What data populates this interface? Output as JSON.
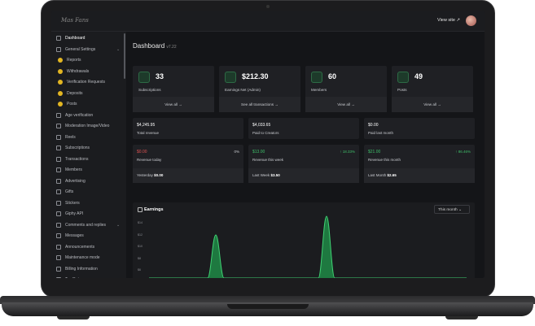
{
  "topbar": {
    "logo": "Mas Fans",
    "view_site": "View site ↗"
  },
  "sidebar": {
    "items": [
      {
        "label": "Dashboard",
        "active": true
      },
      {
        "label": "General Settings",
        "expand": true
      },
      {
        "label": "Reports",
        "sub": true
      },
      {
        "label": "Withdrawals",
        "sub": true
      },
      {
        "label": "Verification Requests",
        "sub": true
      },
      {
        "label": "Deposits",
        "sub": true
      },
      {
        "label": "Posts",
        "sub": true
      },
      {
        "label": "Age verification"
      },
      {
        "label": "Moderation Image/Video"
      },
      {
        "label": "Reels"
      },
      {
        "label": "Subscriptions"
      },
      {
        "label": "Transactions"
      },
      {
        "label": "Members"
      },
      {
        "label": "Advertising"
      },
      {
        "label": "Gifts"
      },
      {
        "label": "Stickers"
      },
      {
        "label": "Giphy API"
      },
      {
        "label": "Comments and replies",
        "expand": true
      },
      {
        "label": "Messages"
      },
      {
        "label": "Announcements"
      },
      {
        "label": "Maintenance mode"
      },
      {
        "label": "Billing Information"
      },
      {
        "label": "Tax Rates"
      }
    ]
  },
  "main": {
    "title": "Dashboard",
    "version": "v7.22",
    "stats": [
      {
        "value": "33",
        "label": "Subscriptions",
        "link": "View all →"
      },
      {
        "value": "$212.30",
        "label": "Earnings Net (Admin)",
        "link": "See all transactions →"
      },
      {
        "value": "60",
        "label": "Members",
        "link": "View all →"
      },
      {
        "value": "49",
        "label": "Posts",
        "link": "View all →"
      }
    ],
    "revenue": [
      {
        "value": "$4,245.95",
        "label": "Total revenue"
      },
      {
        "value": "$4,033.65",
        "label": "Paid to Creators"
      },
      {
        "value": "$0.00",
        "label": "Paid last month"
      }
    ],
    "periods": [
      {
        "value": "$0.00",
        "label": "Revenue today",
        "pct": "0%",
        "foot_label": "Yesterday",
        "foot_value": "$0.00",
        "color": "#e05252",
        "pct_color": "#c9cbd0"
      },
      {
        "value": "$13.00",
        "label": "Revenue this week",
        "pct": "↑ 18.33%",
        "foot_label": "Last Week",
        "foot_value": "$3.50",
        "color": "#3fbf6a",
        "pct_color": "#3fbf6a"
      },
      {
        "value": "$21.00",
        "label": "Revenue this month",
        "pct": "↑ 86.46%",
        "foot_label": "Last Month",
        "foot_value": "$2.65",
        "color": "#3fbf6a",
        "pct_color": "#3fbf6a"
      }
    ],
    "earnings": {
      "title": "Earnings",
      "range": "This month ⌄",
      "y_ticks": [
        "$14",
        "$12",
        "$10",
        "$8",
        "$6",
        "$4"
      ]
    }
  },
  "colors": {
    "accent": "#2ea35a"
  }
}
